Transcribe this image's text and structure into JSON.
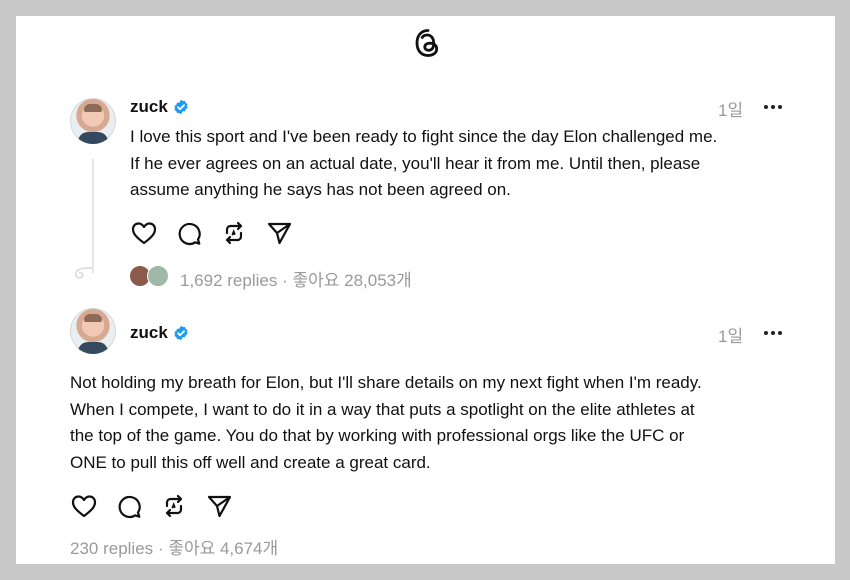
{
  "app": {
    "logo_icon": "threads-logo-icon"
  },
  "posts": [
    {
      "username": "zuck",
      "verified_icon": "verified-badge-icon",
      "time": "1일",
      "text": "I love this sport and I've been ready to fight since the day Elon challenged me.\nIf he ever agrees on an actual date, you'll hear it from me. Until then, please\nassume anything he says has not been agreed on.",
      "stats_replies": "1,692 replies",
      "stats_separator": "·",
      "stats_likes": "좋아요 28,053개"
    },
    {
      "username": "zuck",
      "verified_icon": "verified-badge-icon",
      "time": "1일",
      "text": "Not holding my breath for Elon, but I'll share details on my next fight when I'm ready.\nWhen I compete, I want to do it in a way that puts a spotlight on the elite athletes at\nthe top of the game. You do that by working with professional orgs like the UFC or\nONE to pull this off well and create a great card.",
      "stats_replies": "230 replies",
      "stats_separator": "·",
      "stats_likes": "좋아요 4,674개"
    }
  ],
  "actions": [
    "heart-icon",
    "comment-icon",
    "repost-icon",
    "share-icon"
  ],
  "colors": {
    "verified": "#1d9bf0",
    "muted": "#999999",
    "text": "#111111"
  }
}
